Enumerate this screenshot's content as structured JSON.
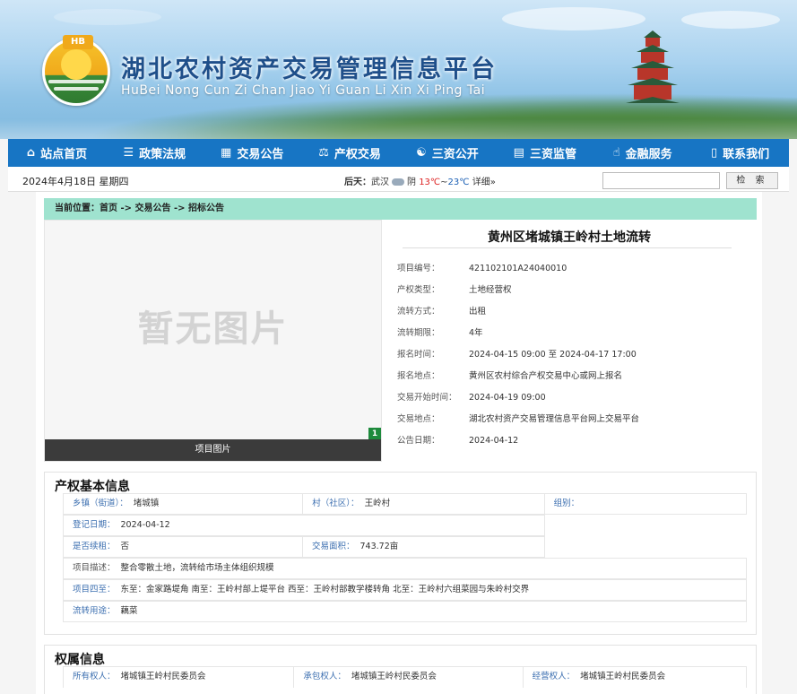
{
  "header": {
    "logo_badge": "HB",
    "title": "湖北农村资产交易管理信息平台",
    "subtitle": "HuBei Nong Cun Zi Chan Jiao Yi Guan Li Xin Xi Ping Tai"
  },
  "nav": {
    "items": [
      {
        "label": "站点首页",
        "icon": "home-icon"
      },
      {
        "label": "政策法规",
        "icon": "list-icon"
      },
      {
        "label": "交易公告",
        "icon": "grid-icon"
      },
      {
        "label": "产权交易",
        "icon": "scale-icon"
      },
      {
        "label": "三资公开",
        "icon": "share-icon"
      },
      {
        "label": "三资监管",
        "icon": "monitor-icon"
      },
      {
        "label": "金融服务",
        "icon": "thumbs-up-icon"
      },
      {
        "label": "联系我们",
        "icon": "phone-icon"
      }
    ]
  },
  "infobar": {
    "date": "2024年4月18日 星期四",
    "weather_prefix": "后天：",
    "city": "武汉",
    "condition": "阴",
    "temp_high": "13℃",
    "temp_sep": "~",
    "temp_low": "23℃",
    "detail": "详细»"
  },
  "search": {
    "placeholder": "",
    "button_label": "检 索"
  },
  "breadcrumb": "当前位置：首页 -> 交易公告 -> 招标公告",
  "image": {
    "placeholder_text": "暂无图片",
    "index": "1",
    "caption": "项目图片"
  },
  "project": {
    "title": "黄州区堵城镇王岭村土地流转",
    "fields": [
      {
        "label": "项目编号：",
        "value": "421102101A24040010"
      },
      {
        "label": "产权类型：",
        "value": "土地经营权"
      },
      {
        "label": "流转方式：",
        "value": "出租"
      },
      {
        "label": "流转期限：",
        "value": "4年"
      },
      {
        "label": "报名时间：",
        "value": "2024-04-15 09:00  至 2024-04-17 17:00"
      },
      {
        "label": "报名地点：",
        "value": "黄州区农村综合产权交易中心或网上报名"
      },
      {
        "label": "交易开始时间：",
        "value": "2024-04-19 09:00"
      },
      {
        "label": "交易地点：",
        "value": "湖北农村资产交易管理信息平台网上交易平台"
      },
      {
        "label": "公告日期：",
        "value": "2024-04-12"
      }
    ]
  },
  "basic_info": {
    "title": "产权基本信息",
    "town_label": "乡镇（街道）：",
    "town_value": "堵城镇",
    "village_label": "村（社区）：",
    "village_value": "王岭村",
    "group_label": "组别：",
    "group_value": "",
    "reg_date_label": "登记日期：",
    "reg_date_value": "2024-04-12",
    "renew_label": "是否续租：",
    "renew_value": "否",
    "area_label": "交易面积：",
    "area_value": "743.72亩",
    "desc_label": "项目描述：",
    "desc_value": "整合零散土地，流转给市场主体组织规模",
    "bounds_label": "项目四至：",
    "bounds_value": "东至：金家路堤角 南至：王岭村部上堤平台 西至：王岭村部教学楼转角 北至：王岭村六组菜园与朱岭村交界",
    "use_label": "流转用途：",
    "use_value": "藕菜"
  },
  "ownership": {
    "title": "权属信息",
    "owner_label": "所有权人：",
    "owner_value": "堵城镇王岭村民委员会",
    "contract_label": "承包权人：",
    "contract_value": "堵城镇王岭村民委员会",
    "operator_label": "经营权人：",
    "operator_value": "堵城镇王岭村民委员会"
  }
}
